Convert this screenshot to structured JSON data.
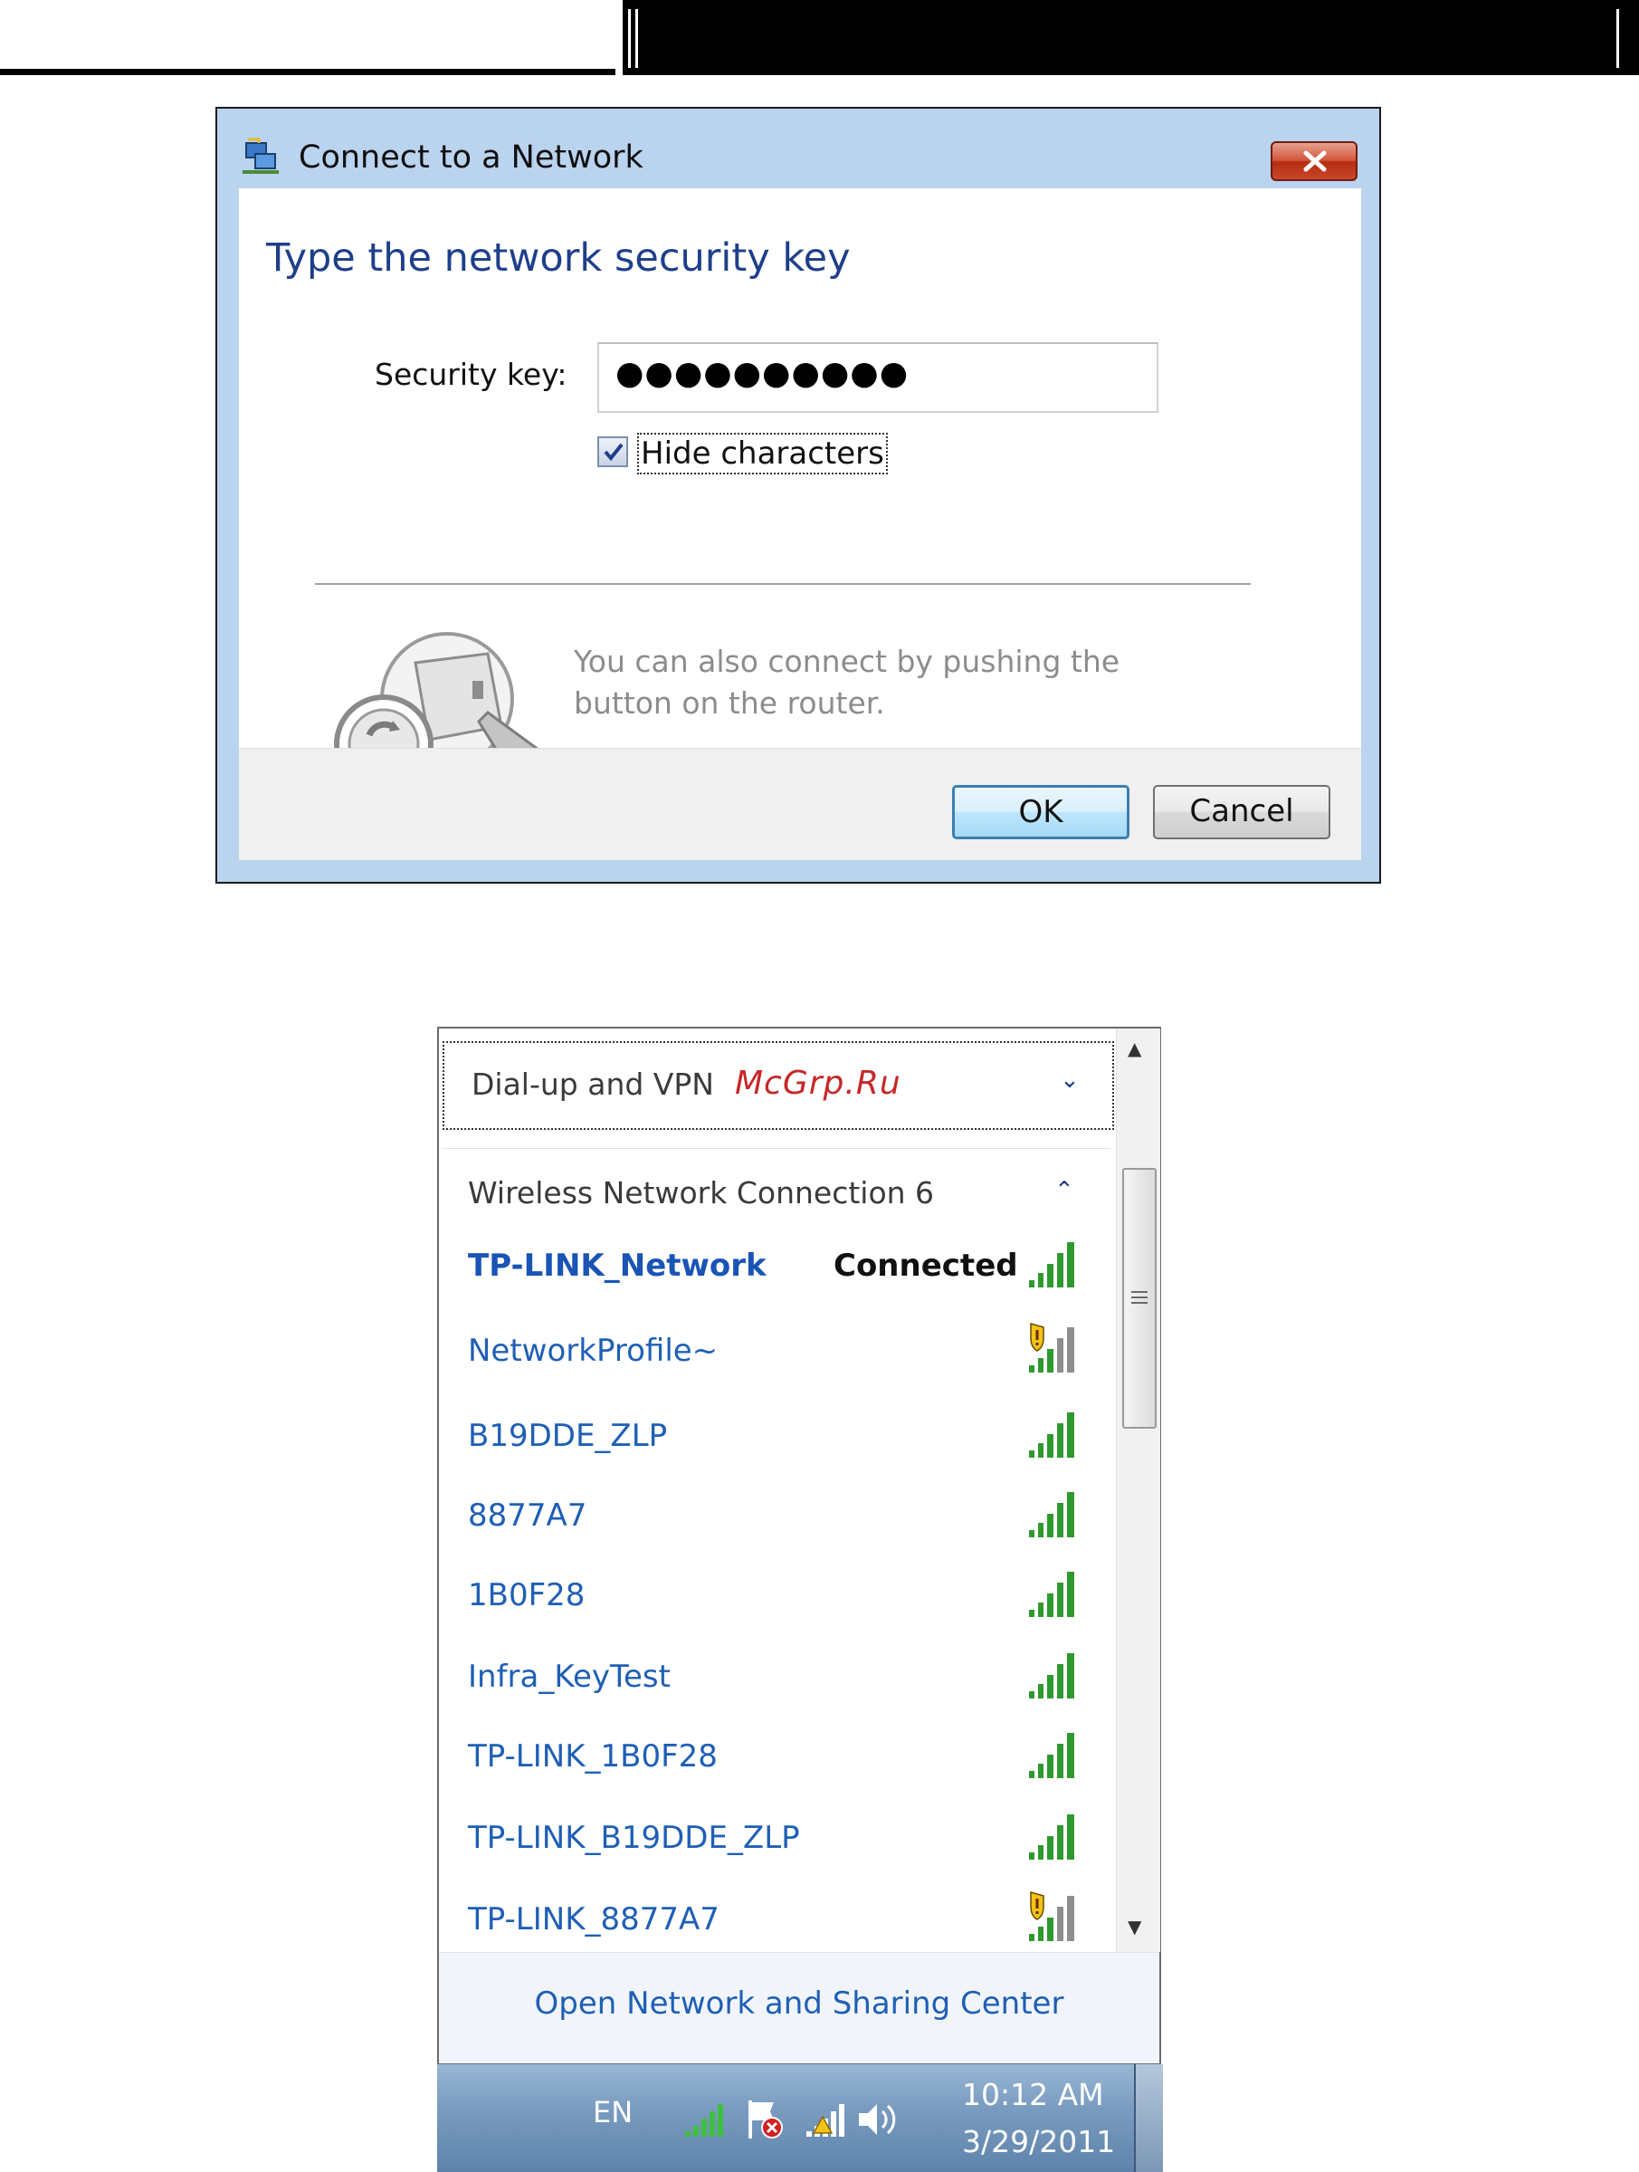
{
  "dialog": {
    "title": "Connect to a Network",
    "heading": "Type the network security key",
    "security_key_label": "Security key:",
    "security_key_value": "●●●●●●●●●●",
    "hide_characters_label": "Hide characters",
    "hide_characters_checked": true,
    "wps_text": "You can also connect by pushing the button on the router.",
    "ok_label": "OK",
    "cancel_label": "Cancel"
  },
  "network_popup": {
    "dialup_label": "Dial-up and VPN",
    "section_label": "Wireless Network Connection 6",
    "networks": [
      {
        "name": "TP-LINK_Network",
        "status": "Connected",
        "secured": false
      },
      {
        "name": "NetworkProfile~",
        "status": "",
        "secured": true
      },
      {
        "name": "B19DDE_ZLP",
        "status": "",
        "secured": false
      },
      {
        "name": "8877A7",
        "status": "",
        "secured": false
      },
      {
        "name": "1B0F28",
        "status": "",
        "secured": false
      },
      {
        "name": "Infra_KeyTest",
        "status": "",
        "secured": false
      },
      {
        "name": "TP-LINK_1B0F28",
        "status": "",
        "secured": false
      },
      {
        "name": "TP-LINK_B19DDE_ZLP",
        "status": "",
        "secured": false
      },
      {
        "name": "TP-LINK_8877A7",
        "status": "",
        "secured": true
      }
    ],
    "footer_link": "Open Network and Sharing Center"
  },
  "taskbar": {
    "language": "EN",
    "time": "10:12 AM",
    "date": "3/29/2011"
  },
  "watermark": "McGrp.Ru",
  "colors": {
    "link_blue": "#1f5fb5",
    "signal_green": "#2e9a2e",
    "close_red": "#c9462a"
  }
}
